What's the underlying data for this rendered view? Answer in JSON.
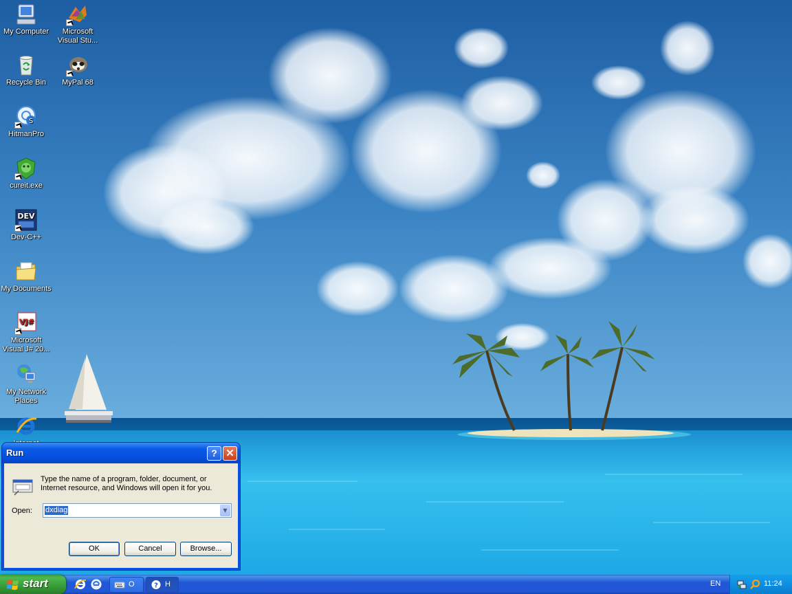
{
  "desktop": {
    "icons": [
      {
        "label": "My Computer",
        "icon": "my-computer-icon"
      },
      {
        "label": "Microsoft Visual Stu...",
        "icon": "visual-studio-icon"
      },
      {
        "label": "Recycle Bin",
        "icon": "recycle-bin-icon"
      },
      {
        "label": "MyPal 68",
        "icon": "mypal-icon"
      },
      {
        "label": "HitmanPro",
        "icon": "hitmanpro-icon"
      },
      {
        "label": "cureit.exe",
        "icon": "cureit-icon"
      },
      {
        "label": "Dev-C++",
        "icon": "devcpp-icon"
      },
      {
        "label": "My Documents",
        "icon": "my-documents-icon"
      },
      {
        "label": "Microsoft Visual J# 20...",
        "icon": "visual-jsharp-icon"
      },
      {
        "label": "My Network Places",
        "icon": "network-places-icon"
      },
      {
        "label": "Internet",
        "icon": "internet-explorer-icon"
      }
    ]
  },
  "run_dialog": {
    "title": "Run",
    "help_button": "?",
    "close_button": "✕",
    "description": "Type the name of a program, folder, document, or Internet resource, and Windows will open it for you.",
    "open_label": "Open:",
    "open_value": "dxdiag",
    "ok_label": "OK",
    "cancel_label": "Cancel",
    "browse_label": "Browse..."
  },
  "taskbar": {
    "start_label": "start",
    "tasks": [
      {
        "label": "O",
        "icon": "keyboard-icon"
      },
      {
        "label": "H",
        "icon": "help-icon"
      }
    ],
    "language": "EN",
    "clock": "11:24"
  },
  "colors": {
    "title_bar": "#0a53e1",
    "dialog_bg": "#ece9d8",
    "taskbar": "#2157d7",
    "start_button": "#3c9a3c",
    "tray": "#0f8ee0"
  }
}
